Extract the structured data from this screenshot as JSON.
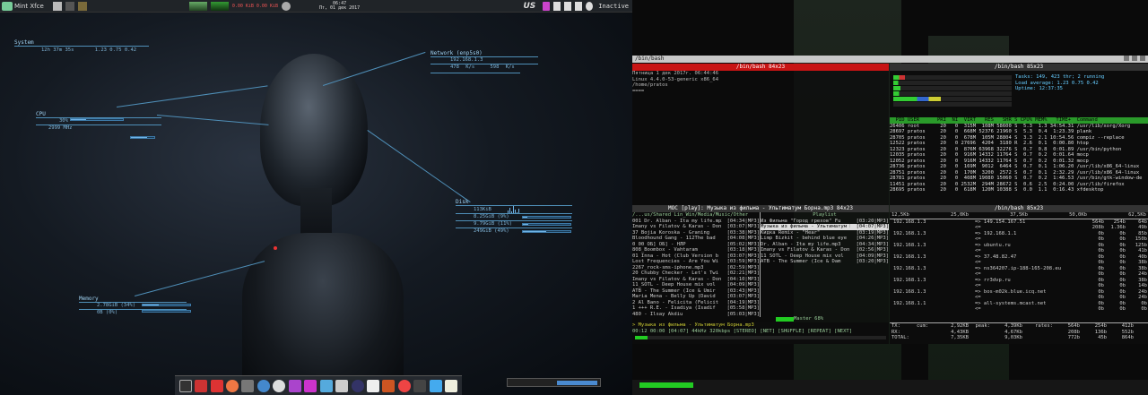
{
  "topbar": {
    "menu": "Mint Xfce",
    "cpu_net": "0.00 KiB  0.00 KiB",
    "clock": "06:47",
    "date": "Пт, 01 дек 2017",
    "layout": "US",
    "status": "Inactive"
  },
  "conky": {
    "system": {
      "title": "System",
      "uptime": "12h 37m 35s",
      "load": "1.23 0.75 0.42"
    },
    "network": {
      "title": "Network (enp5s0)",
      "ip": "192.168.1.3",
      "down": "478",
      "up": "598",
      "unit": "K/s"
    },
    "cpu": {
      "title": "CPU",
      "pct": "30%",
      "freq": "2999 MHz",
      "pct_value": 0.3
    },
    "disk": {
      "title": "Disk",
      "io": "113KiB",
      "rows": [
        {
          "v": "8.25GiB (9%)",
          "f": 0.09
        },
        {
          "v": "9.79GiB (11%)",
          "f": 0.11
        },
        {
          "v": "249GiB (49%)",
          "f": 0.49
        }
      ]
    },
    "memory": {
      "title": "Memory",
      "ram": "2.78GiB (34%)",
      "swap": "0B (0%)",
      "ram_f": 0.34,
      "swap_f": 0
    }
  },
  "term": {
    "window_title": "/bin/bash",
    "pane1": {
      "title": "/bin/bash 84x23",
      "lines": [
        "Пятница 1 дек 2017г. 06:44:46",
        "Linux 4.4.0-53-generic x86_64",
        "/home/pratos",
        "===="
      ]
    },
    "pane2": {
      "title": "/bin/bash 85x23",
      "summary": [
        "Tasks: 149, 423 thr; 2 running",
        "Load average: 1.23 0.75 0.42",
        "Uptime: 12:37:35"
      ],
      "header": "  PID USER      PRI  NI  VIRT   RES   SHR S CPU% MEM%   TIME+  Command",
      "rows": [
        "26406 root       20   0  315M  108M 58600 S  5.3  1.3 34:54.31 /usr/lib/xorg/Xorg",
        "28697 pratos     20   0  668M 52376 21960 S  5.3  0.4  1:23.39 plank",
        "28705 pratos     20   0  678M  105M 28804 S  3.3  2.1 10:54.56 compiz --replace",
        "12522 pratos     20   0 27696  4204  3180 R  2.6  0.1  0:00.80 htop",
        "12323 pratos     20   0  876M 63968 32276 S  0.7  0.8  0:01.89 /usr/bin/python",
        "12035 pratos     20   0  916M 14332 11764 S  0.7  0.2  0:01.64 mocp",
        "12052 pratos     20   0  916M 14332 11764 S  0.7  0.2  0:01.32 mocp",
        "28736 pratos     20   0  169M  9012  6464 S  0.7  0.1  1:06.20 /usr/lib/x86_64-linux",
        "28751 pratos     20   0  170M  3200  2572 S  0.7  0.1  2:32.29 /usr/lib/x86_64-linux",
        "28781 pratos     20   0  408M 19080 15060 S  0.7  0.2  1:46.53 /usr/bin/gtk-window-de",
        "11451 pratos     20   0 2532M  294M 28672 S  0.6  2.5  0:24.00 /usr/lib/firefox",
        "28695 pratos     20   0  618M  120M 10388 S  0.0  1.1  0:16.43 xfdesktop"
      ]
    },
    "pane3": {
      "title": "MOC [play]: Музыка из фильма - Ультиматум Борна.mp3 84x23",
      "path": "/...us/Shared Lin_Win/Media/Music/Other",
      "files": [
        "001 Dr. Alban - Ita my life.mp3",
        "Imany vs Filatov & Karas - Don't",
        "37 Bojia Koroska - Graning",
        "Bloodhound Gang - 112The bad",
        "0 00 ОБ] ОБ] - НЛР",
        "808_Boombox - Vahtaram",
        "01 Inna - Hot (Club Version b",
        "Lost Frequencies - Are You Wi",
        "2267_rock-sms-iphone.mp3",
        "20 Chubby Checker - Let's Twi",
        "Imany vs Filatov & Karas - Don",
        "11_SOTL - Deep House mix vol",
        "ATB - The Summer (Ice & Umir",
        "Maria Mena - Belly Up (David",
        "2 Al Bano - Felicita (Felicit",
        "1 +++ R.E. - Isadiya (Isadif",
        "480 - Ilsay Akdiu"
      ],
      "times": [
        "[04:34|MP3]",
        "[03:07|MP3]",
        "[03:38|MP3]",
        "[04:08|MP3]",
        "[05:02|MP3]",
        "[03:18|MP3]",
        "[03:07|MP3]",
        "[03:59|MP3]",
        "[02:59|MP3]",
        "[02:21|MP3]",
        "[04:10|MP3]",
        "[04:09|MP3]",
        "[03:43|MP3]",
        "[03:07|MP3]",
        "[04:19|MP3]",
        "[05:58|MP3]",
        "[05:03|MP3]"
      ],
      "playlist_title": "Playlist",
      "playlist": [
        "Из Фильма \"Город грехов\" Fu",
        "Музыка из фильма - Ультиматум Борна.mp3",
        "Кидка Remix - \"Hear\"",
        "Limp Bizkit - behind blue eye",
        "Dr. Alban - Ita my life.mp3",
        "Imany vs Filatov & Karas - Don",
        "11 SOTL - Deep House mix vol",
        "ATB - The Summer (Ice & Dam"
      ],
      "ptimes": [
        "[03:20|MP3]",
        "[04:07|MP3]",
        "[03:19|MP3]",
        "[04:26|MP3]",
        "[04:34|MP3]",
        "[02:56|MP3]",
        "[04:09|MP3]",
        "[03:20|MP3]"
      ],
      "playing": "> Музыка из фильма - Ультиматум Борна.mp3",
      "status": "00:12 00:00 [04:07] 44kHz 320kbps [STEREO] [NET] [SHUFFLE] [REPEAT] [NEXT]",
      "volume": "Master 68%",
      "progress": 0.05
    },
    "pane4": {
      "title": "/bin/bash 85x23",
      "scale": [
        "12,5Kb",
        "25,0Kb",
        "37,5Kb",
        "50,0Kb",
        "62,5Kb"
      ],
      "hosts": [
        {
          "src": "192.168.1.3",
          "dst": "=> 149.154.167.51",
          "r": [
            "564b",
            "254b",
            "64b"
          ]
        },
        {
          "src": "",
          "dst": "<=",
          "r": [
            "208b",
            "1.36b",
            "49b"
          ]
        },
        {
          "src": "192.168.1.3",
          "dst": "=> 192.168.1.1",
          "r": [
            "0b",
            "0b",
            "85b"
          ]
        },
        {
          "src": "",
          "dst": "<=",
          "r": [
            "0b",
            "0b",
            "150b"
          ]
        },
        {
          "src": "192.168.1.3",
          "dst": "=> ubuntu.ru",
          "r": [
            "0b",
            "0b",
            "125b"
          ]
        },
        {
          "src": "",
          "dst": "<=",
          "r": [
            "0b",
            "0b",
            "41b"
          ]
        },
        {
          "src": "192.168.1.3",
          "dst": "=> 37.48.82.47",
          "r": [
            "0b",
            "0b",
            "40b"
          ]
        },
        {
          "src": "",
          "dst": "<=",
          "r": [
            "0b",
            "0b",
            "38b"
          ]
        },
        {
          "src": "192.168.1.3",
          "dst": "=> ns364207.ip-188-165-208.eu",
          "r": [
            "0b",
            "0b",
            "38b"
          ]
        },
        {
          "src": "",
          "dst": "<=",
          "r": [
            "0b",
            "0b",
            "24b"
          ]
        },
        {
          "src": "192.168.1.3",
          "dst": "=> rr3dvp.ru",
          "r": [
            "0b",
            "0b",
            "38b"
          ]
        },
        {
          "src": "",
          "dst": "<=",
          "r": [
            "0b",
            "0b",
            "14b"
          ]
        },
        {
          "src": "192.168.1.3",
          "dst": "=> bos-m02k.blue.icq.net",
          "r": [
            "0b",
            "0b",
            "24b"
          ]
        },
        {
          "src": "",
          "dst": "<=",
          "r": [
            "0b",
            "0b",
            "24b"
          ]
        },
        {
          "src": "192.168.1.1",
          "dst": "=> all-systems.mcast.net",
          "r": [
            "0b",
            "0b",
            "0b"
          ]
        },
        {
          "src": "",
          "dst": "<=",
          "r": [
            "0b",
            "0b",
            "0b"
          ]
        }
      ],
      "totals": [
        {
          "k": "TX:",
          "cum": "2,92KB",
          "peak": "4,39Kb",
          "rates": [
            "564b",
            "254b",
            "412b"
          ]
        },
        {
          "k": "RX:",
          "cum": "4,43KB",
          "peak": "4,67Kb",
          "rates": [
            "208b",
            "136b",
            "552b"
          ]
        },
        {
          "k": "TOTAL:",
          "cum": "7,35KB",
          "peak": "9,03Kb",
          "rates": [
            "772b",
            "45b",
            "864b"
          ]
        }
      ],
      "labels": {
        "cum": "cum:",
        "peak": "peak:",
        "rates": "rates:"
      }
    }
  }
}
